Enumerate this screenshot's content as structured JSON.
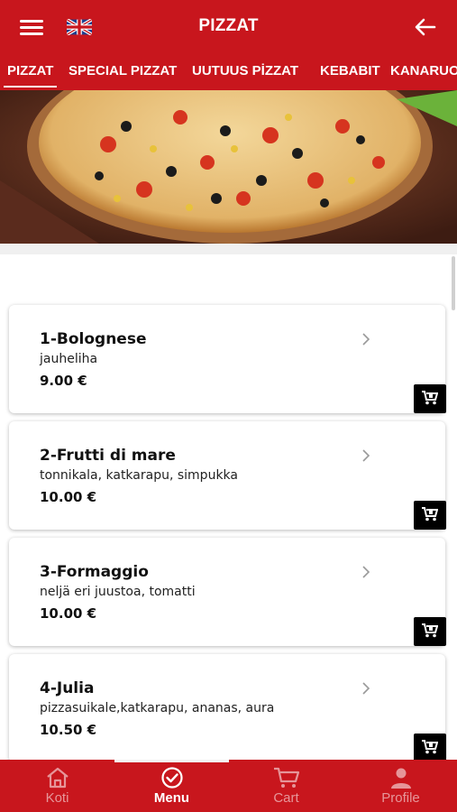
{
  "header": {
    "title": "PIZZAT",
    "language_icon": "uk-flag-icon",
    "menu_icon": "hamburger-icon",
    "back_icon": "arrow-left-icon"
  },
  "tabs": [
    {
      "label": "PIZZAT",
      "active": true
    },
    {
      "label": "SPECIAL PIZZAT",
      "active": false
    },
    {
      "label": "UUTUUS PİZZAT",
      "active": false
    },
    {
      "label": "KEBABIT",
      "active": false
    },
    {
      "label": "KANARUOAT",
      "active": false
    }
  ],
  "products": [
    {
      "name": "1-Bolognese",
      "description": "jauheliha",
      "price": "9.00 €"
    },
    {
      "name": "2-Frutti di mare",
      "description": "tonnikala, katkarapu, simpukka",
      "price": "10.00 €"
    },
    {
      "name": "3-Formaggio",
      "description": "neljä eri juustoa, tomatti",
      "price": "10.00 €"
    },
    {
      "name": "4-Julia",
      "description": "pizzasuikale,katkarapu, ananas, aura",
      "price": "10.50 €"
    }
  ],
  "bottom_nav": [
    {
      "label": "Koti",
      "icon": "home-icon",
      "active": false
    },
    {
      "label": "Menu",
      "icon": "check-circle-icon",
      "active": true
    },
    {
      "label": "Cart",
      "icon": "cart-icon",
      "active": false
    },
    {
      "label": "Profile",
      "icon": "person-icon",
      "active": false
    }
  ],
  "colors": {
    "primary": "#c8161d",
    "cart_button": "#000000"
  }
}
